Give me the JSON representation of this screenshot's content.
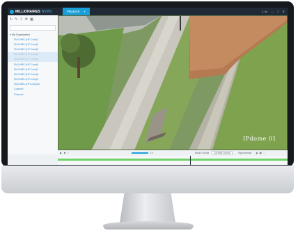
{
  "app": {
    "brand": "MILLIONAIRES",
    "brand_sub": "NVMS",
    "tab_label": "Playback",
    "tab_close": "×",
    "status": "1.4x"
  },
  "panel": {
    "root_label": "My Organization",
    "cameras": [
      "NVJ-NRC-(HF-Cam)1",
      "NVJ-NRC-(HF-Cam)2",
      "NVJ-NRC-(HF-Cam)3",
      "NVJ-NRC-(HF-Cam)4",
      "NVJ-NRC-(HF-Cam)5",
      "NVJ-NRC-(HF-Cam)6",
      "NVJ-NRC-(HF-Cam)7",
      "NVJ-NRC-(HF-Cam)8",
      "NVJ-NRC-(HF-Cam)9",
      "NVJ-NRC-(HF-Cam)10"
    ],
    "folders": [
      "Channel",
      "Channel"
    ]
  },
  "video": {
    "osd_label": "IPdome 01"
  },
  "controls": {
    "speed_label": "1X",
    "mode_label": "Mode Choice",
    "device_label": "All Web Device",
    "sync_label": "Synchronize"
  },
  "colors": {
    "titlebar": "#1f2a36",
    "accent": "#1a9ed8",
    "timeline": "#6fd36a"
  }
}
